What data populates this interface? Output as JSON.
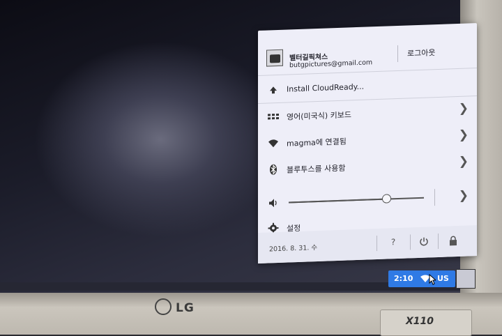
{
  "tray": {
    "user_name": "벨터길픽쳐스",
    "user_email": "butgpictures@gmail.com",
    "logout_label": "로그아웃",
    "items": [
      {
        "label": "Install CloudReady...",
        "icon": "upload-arrow-icon",
        "has_chevron": false
      },
      {
        "label": "영어(미국식) 키보드",
        "icon": "keyboard-icon",
        "has_chevron": true
      },
      {
        "label": "magma에 연결됨",
        "icon": "wifi-icon",
        "has_chevron": true
      },
      {
        "label": "블루투스를 사용함",
        "icon": "bluetooth-icon",
        "has_chevron": true
      },
      {
        "label": "설정",
        "icon": "gear-icon",
        "has_chevron": false
      }
    ],
    "volume_level": 0.72,
    "date": "2016. 8. 31. 수",
    "help_label": "?"
  },
  "shelf": {
    "time": "2:10",
    "input_method": "US",
    "accent_color": "#2f7ae5"
  },
  "branding": {
    "logo_text": "LG",
    "model_text": "X110"
  }
}
